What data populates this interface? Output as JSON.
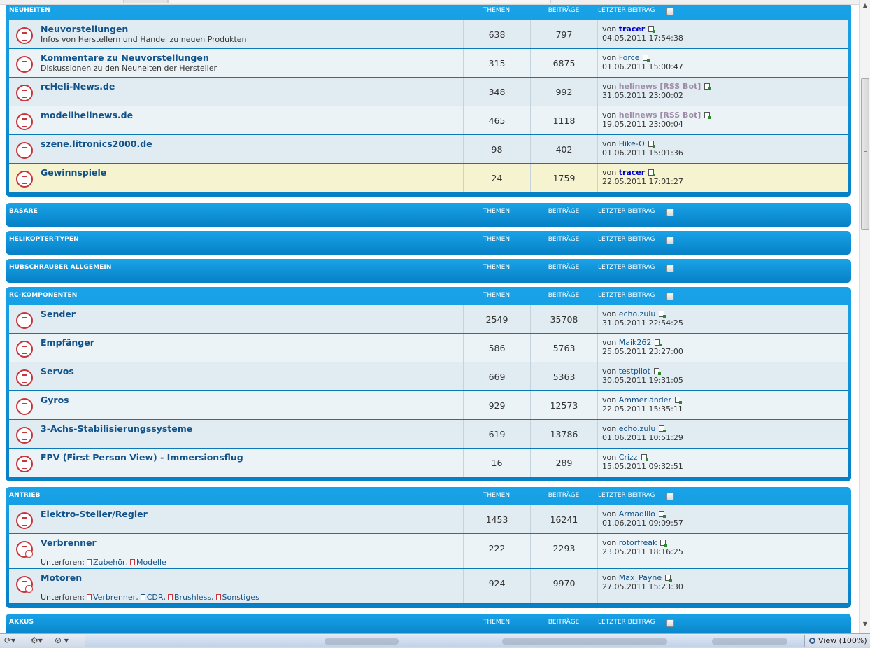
{
  "header_labels": {
    "topics": "THEMEN",
    "posts": "BEITRÄGE",
    "last_post": "LETZTER BEITRAG"
  },
  "categories": [
    {
      "title": "NEUHEITEN",
      "forums": [
        {
          "name": "Neuvorstellungen",
          "desc": "Infos von Herstellern und Handel zu neuen Produkten",
          "topics": "638",
          "posts": "797",
          "by": "von",
          "user": "tracer",
          "user_style": "admin",
          "date": "04.05.2011 17:54:38"
        },
        {
          "name": "Kommentare zu Neuvorstellungen",
          "desc": "Diskussionen zu den Neuheiten der Hersteller",
          "topics": "315",
          "posts": "6875",
          "by": "von",
          "user": "Force",
          "user_style": "normal",
          "date": "01.06.2011 15:00:47"
        },
        {
          "name": "rcHeli-News.de",
          "desc": "",
          "topics": "348",
          "posts": "992",
          "by": "von",
          "user": "helinews [RSS Bot]",
          "user_style": "bot",
          "date": "31.05.2011 23:00:02"
        },
        {
          "name": "modellhelinews.de",
          "desc": "",
          "topics": "465",
          "posts": "1118",
          "by": "von",
          "user": "helinews [RSS Bot]",
          "user_style": "bot",
          "date": "19.05.2011 23:00:04"
        },
        {
          "name": "szene.litronics2000.de",
          "desc": "",
          "topics": "98",
          "posts": "402",
          "by": "von",
          "user": "Hike-O",
          "user_style": "normal",
          "date": "01.06.2011 15:01:36"
        },
        {
          "name": "Gewinnspiele",
          "desc": "",
          "topics": "24",
          "posts": "1759",
          "by": "von",
          "user": "tracer",
          "user_style": "admin",
          "date": "22.05.2011 17:01:27"
        }
      ]
    },
    {
      "title": "BASARE",
      "forums": []
    },
    {
      "title": "HELIKOPTER-TYPEN",
      "forums": []
    },
    {
      "title": "HUBSCHRAUBER ALLGEMEIN",
      "forums": []
    },
    {
      "title": "RC-KOMPONENTEN",
      "forums": [
        {
          "name": "Sender",
          "desc": "",
          "topics": "2549",
          "posts": "35708",
          "by": "von",
          "user": "echo.zulu",
          "user_style": "normal",
          "date": "31.05.2011 22:54:25"
        },
        {
          "name": "Empfänger",
          "desc": "",
          "topics": "586",
          "posts": "5763",
          "by": "von",
          "user": "Maik262",
          "user_style": "normal",
          "date": "25.05.2011 23:27:00"
        },
        {
          "name": "Servos",
          "desc": "",
          "topics": "669",
          "posts": "5363",
          "by": "von",
          "user": "testpilot",
          "user_style": "normal",
          "date": "30.05.2011 19:31:05"
        },
        {
          "name": "Gyros",
          "desc": "",
          "topics": "929",
          "posts": "12573",
          "by": "von",
          "user": "Ammerländer",
          "user_style": "normal",
          "date": "22.05.2011 15:35:11"
        },
        {
          "name": "3-Achs-Stabilisierungssysteme",
          "desc": "",
          "topics": "619",
          "posts": "13786",
          "by": "von",
          "user": "echo.zulu",
          "user_style": "normal",
          "date": "01.06.2011 10:51:29"
        },
        {
          "name": "FPV (First Person View) - Immersionsflug",
          "desc": "",
          "topics": "16",
          "posts": "289",
          "by": "von",
          "user": "Crizz",
          "user_style": "normal",
          "date": "15.05.2011 09:32:51"
        }
      ]
    },
    {
      "title": "ANTRIEB",
      "forums": [
        {
          "name": "Elektro-Steller/Regler",
          "desc": "",
          "topics": "1453",
          "posts": "16241",
          "by": "von",
          "user": "Armadillo",
          "user_style": "normal",
          "date": "01.06.2011 09:09:57"
        },
        {
          "name": "Verbrenner",
          "subforums_label": "Unterforen:",
          "subforums": [
            "Zubehör,",
            "Modelle"
          ],
          "topics": "222",
          "posts": "2293",
          "by": "von",
          "user": "rotorfreak",
          "user_style": "normal",
          "date": "23.05.2011 18:16:25"
        },
        {
          "name": "Motoren",
          "subforums_label": "Unterforen:",
          "subforums": [
            "Verbrenner,",
            "CDR,",
            "Brushless,",
            "Sonstiges"
          ],
          "topics": "924",
          "posts": "9970",
          "by": "von",
          "user": "Max_Payne",
          "user_style": "normal",
          "date": "27.05.2011 15:23:30"
        }
      ]
    },
    {
      "title": "AKKUS",
      "forums": []
    }
  ],
  "statusbar": {
    "zoom_label": "View (100%)",
    "icons": [
      "refresh-icon",
      "share-icon",
      "compat-icon"
    ]
  },
  "colors": {
    "category_bg": "#0a8ad4",
    "row_bg": "#e1ebf2",
    "row_alt_bg": "#ecf3f7",
    "row_highlight_bg": "#f6f4d0",
    "forum_link": "#105289",
    "admin_user": "#0000cc",
    "bot_user": "#9e8da7"
  }
}
